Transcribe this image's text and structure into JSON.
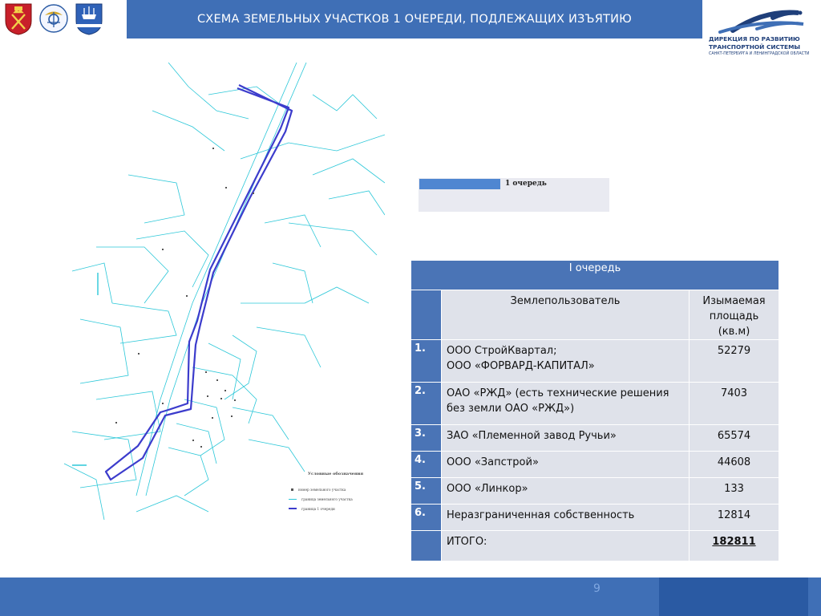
{
  "header": {
    "title": "СХЕМА ЗЕМЕЛЬНЫХ УЧАСТКОВ 1 ОЧЕРЕДИ, ПОДЛЕЖАЩИХ ИЗЪЯТИЮ",
    "emblems": [
      "spb-coat-of-arms-icon",
      "ministry-transport-emblem-icon",
      "leningrad-oblast-coat-of-arms-icon"
    ],
    "logo": {
      "line1": "ДИРЕКЦИЯ ПО РАЗВИТИЮ",
      "line2": "ТРАНСПОРТНОЙ СИСТЕМЫ",
      "line3": "САНКТ-ПЕТЕРБУРГА И ЛЕНИНГРАДСКОЙ ОБЛАСТИ"
    }
  },
  "map": {
    "legend_title": "Условные обозначения",
    "legend_items": [
      {
        "label": "номер земельного участка",
        "color": "#555555"
      },
      {
        "label": "граница земельного участка",
        "color": "#2bc7d8"
      },
      {
        "label": "граница 1 очереди",
        "color": "#3c3ccc"
      }
    ]
  },
  "queue_legend": {
    "label": "1 очередь",
    "color": "#4f86d1"
  },
  "table": {
    "title": "I очередь",
    "col_user": "Землепользователь",
    "col_area": "Изымаемая площадь (кв.м)",
    "rows": [
      {
        "num": "1.",
        "name": "ООО СтройКвартал;\nООО «ФОРВАРД-КАПИТАЛ»",
        "area": "52279"
      },
      {
        "num": "2.",
        "name": "ОАО «РЖД» (есть технические решения без земли ОАО «РЖД»)",
        "area": "7403"
      },
      {
        "num": "3.",
        "name": "ЗАО «Племенной завод Ручьи»",
        "area": "65574"
      },
      {
        "num": "4.",
        "name": "ООО «Запстрой»",
        "area": "44608"
      },
      {
        "num": "5.",
        "name": "ООО «Линкор»",
        "area": "133"
      },
      {
        "num": "6.",
        "name": "Неразграниченная собственность",
        "area": "12814"
      }
    ],
    "total_label": "ИТОГО:",
    "total_area": "182811"
  },
  "footer": {
    "page_number": "9"
  },
  "colors": {
    "brand_blue": "#3f6fb6",
    "table_header": "#4a74b6",
    "table_cell": "#dfe2ea",
    "map_lines": "#2bc7d8",
    "boundary": "#3c3ccc"
  }
}
